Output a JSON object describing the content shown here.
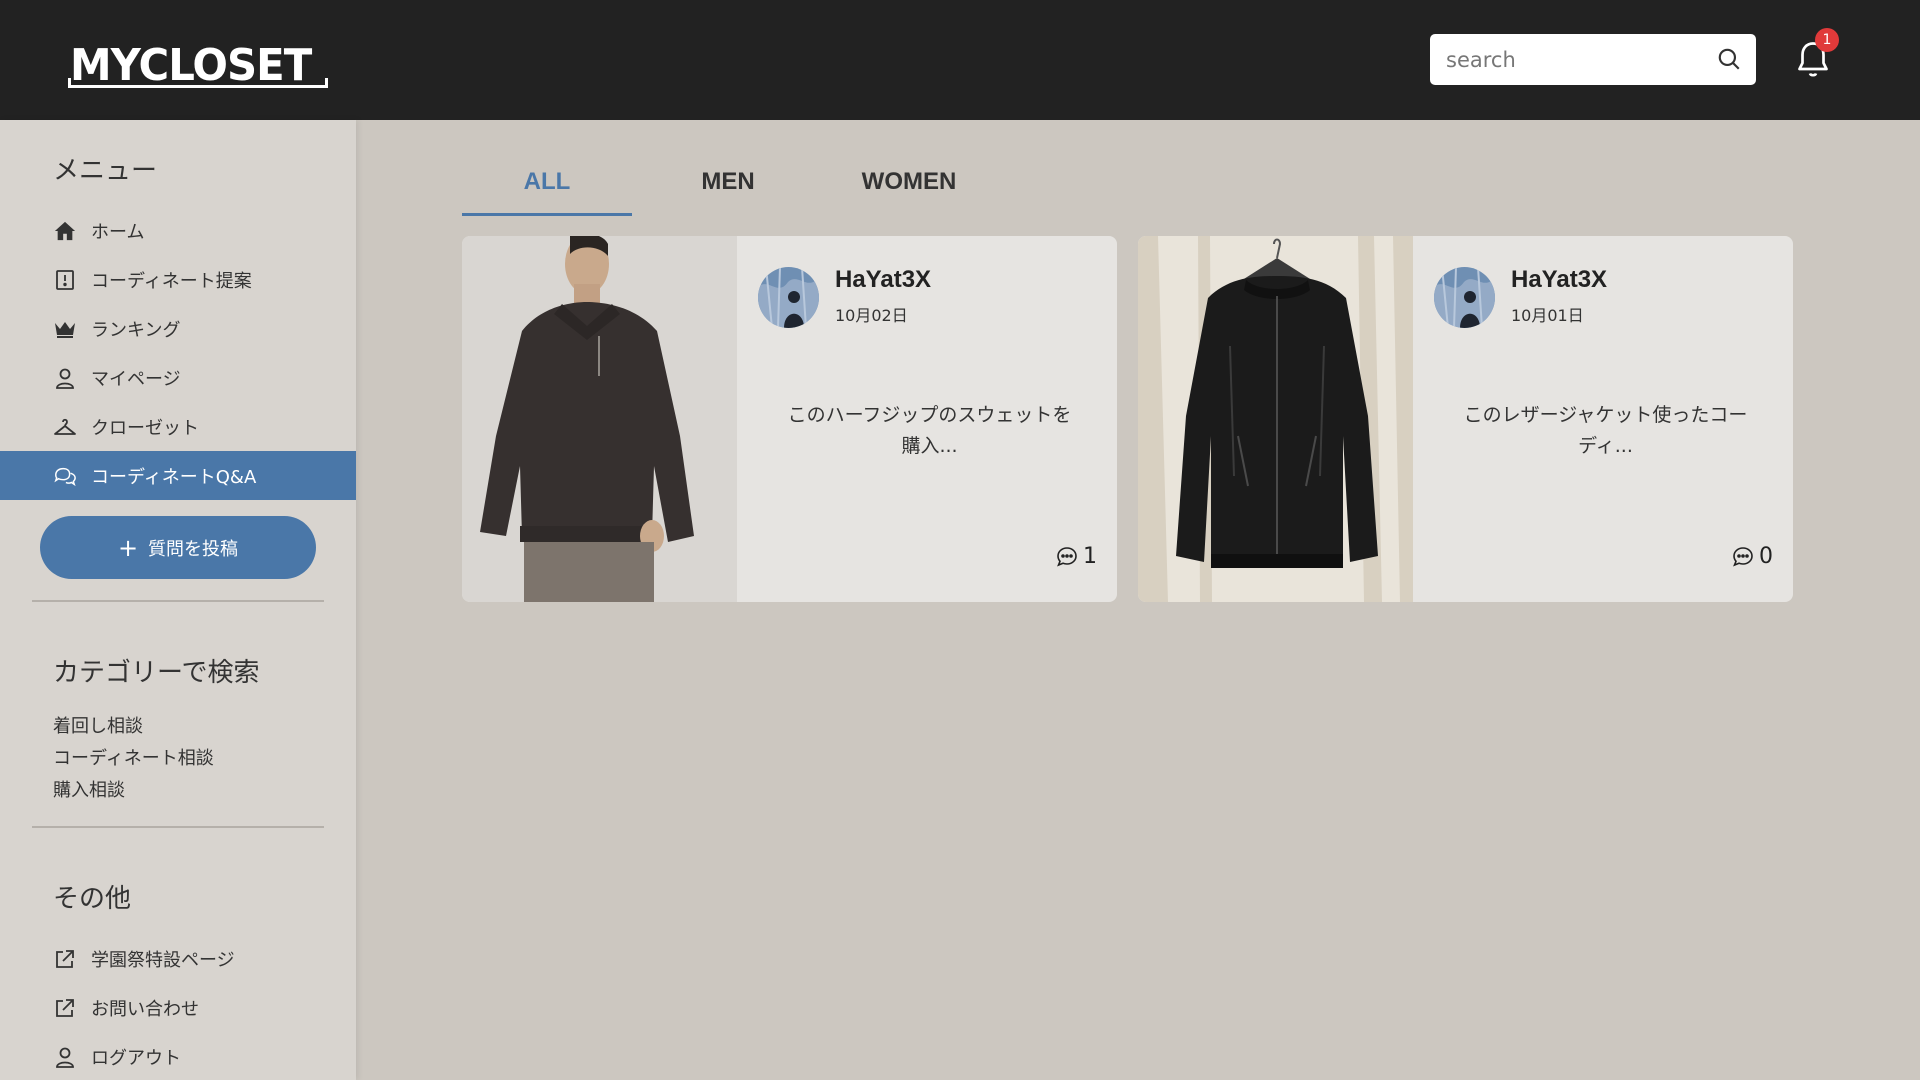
{
  "header": {
    "logo_text": "MYCLOSET",
    "search_placeholder": "search",
    "notification_count": "1"
  },
  "sidebar": {
    "menu_heading": "メニュー",
    "items": [
      {
        "label": "ホーム",
        "icon": "home-icon"
      },
      {
        "label": "コーディネート提案",
        "icon": "suggestion-icon"
      },
      {
        "label": "ランキング",
        "icon": "crown-icon"
      },
      {
        "label": "マイページ",
        "icon": "user-icon"
      },
      {
        "label": "クローゼット",
        "icon": "hanger-icon"
      },
      {
        "label": "コーディネートQ&A",
        "icon": "chat-icon",
        "active": true
      }
    ],
    "post_button_label": "質問を投稿",
    "category_heading": "カテゴリーで検索",
    "categories": [
      "着回し相談",
      "コーディネート相談",
      "購入相談"
    ],
    "other_heading": "その他",
    "other_items": [
      {
        "label": "学園祭特設ページ",
        "icon": "external-link-icon"
      },
      {
        "label": "お問い合わせ",
        "icon": "external-link-icon"
      },
      {
        "label": "ログアウト",
        "icon": "user-icon"
      }
    ]
  },
  "tabs": [
    {
      "label": "ALL",
      "active": true
    },
    {
      "label": "MEN"
    },
    {
      "label": "WOMEN"
    }
  ],
  "posts": [
    {
      "username": "HaYat3X",
      "date": "10月02日",
      "excerpt_line1": "このハーフジップのスウェットを",
      "excerpt_line2": "購入...",
      "comment_count": "1"
    },
    {
      "username": "HaYat3X",
      "date": "10月01日",
      "excerpt_line1": "このレザージャケット使ったコー",
      "excerpt_line2": "ディ...",
      "comment_count": "0"
    }
  ],
  "colors": {
    "header_bg": "#222222",
    "accent": "#4a77a8",
    "page_bg": "#ccc7c0",
    "sidebar_bg": "#d8d4cf",
    "badge": "#e03a3a"
  }
}
